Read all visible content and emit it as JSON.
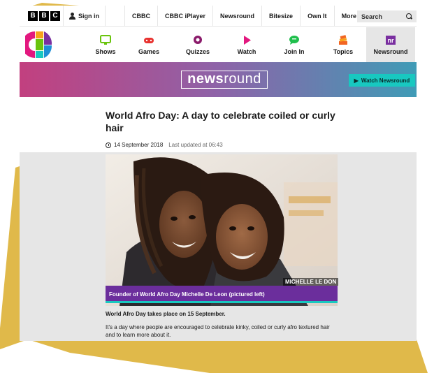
{
  "bbc": {
    "logo_letters": [
      "B",
      "B",
      "C"
    ],
    "sign_in": "Sign in",
    "nav": [
      "CBBC",
      "CBBC iPlayer",
      "Newsround",
      "Bitesize",
      "Own It",
      "More"
    ],
    "search_placeholder": "Search"
  },
  "cbbc_nav": [
    {
      "label": "Shows",
      "icon": "tv-icon",
      "color": "#6ac40e"
    },
    {
      "label": "Games",
      "icon": "gamepad-icon",
      "color": "#e8322f"
    },
    {
      "label": "Quizzes",
      "icon": "quiz-icon",
      "color": "#8a1a6a"
    },
    {
      "label": "Watch",
      "icon": "play-icon",
      "color": "#e3187f"
    },
    {
      "label": "Join In",
      "icon": "speech-icon",
      "color": "#1fbf4c"
    },
    {
      "label": "Topics",
      "icon": "stack-icon",
      "color": "#f26522"
    },
    {
      "label": "Newsround",
      "icon": "nr-icon",
      "color": "#7a2fa0"
    }
  ],
  "newsround": {
    "logo_bold": "news",
    "logo_light": "round",
    "watch_label": "Watch Newsround"
  },
  "article": {
    "title": "World Afro Day: A day to celebrate coiled or curly hair",
    "date": "14 September 2018",
    "updated": "Last updated at 06:43",
    "photo_credit": "MICHELLE LE DON",
    "caption": "Founder of World Afro Day Michelle De Leon (pictured left)",
    "intro": "World Afro Day takes place on 15 September.",
    "body": "It's a day where people are encouraged to celebrate kinky, coiled or curly afro textured hair and to learn more about it."
  },
  "colors": {
    "banner_start": "#c2407f",
    "banner_end": "#3f9bb6",
    "accent_teal": "#18c8c0",
    "caption_purple": "#6b2e9c",
    "gold": "#e0b94a"
  }
}
